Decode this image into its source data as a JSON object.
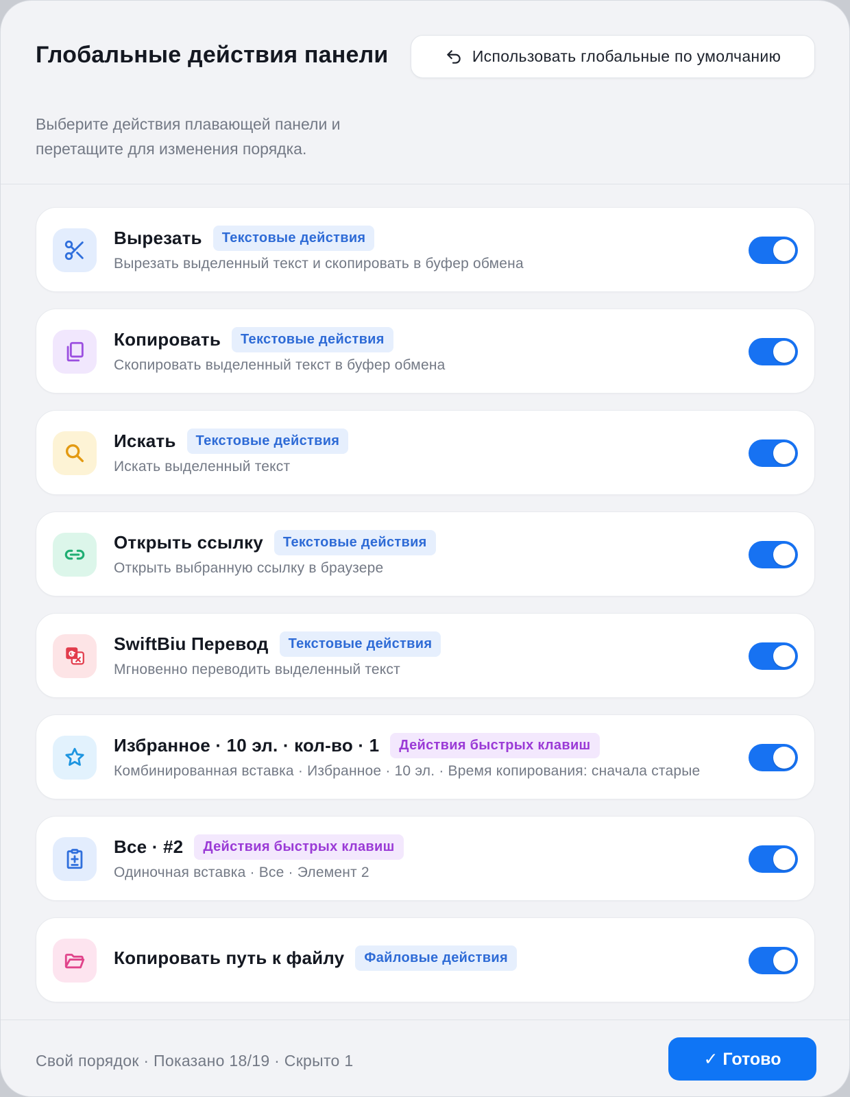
{
  "header": {
    "title": "Глобальные действия панели",
    "subtitle": "Выберите действия плавающей панели и перетащите для изменения порядка.",
    "reset_label": "Использовать глобальные по умолчанию"
  },
  "actions": [
    {
      "icon": "scissors-icon",
      "title": "Вырезать",
      "tag": "Текстовые действия",
      "desc": "Вырезать выделенный текст и скопировать в буфер обмена",
      "enabled": true
    },
    {
      "icon": "copy-icon",
      "title": "Копировать",
      "tag": "Текстовые действия",
      "desc": "Скопировать выделенный текст в буфер обмена",
      "enabled": true
    },
    {
      "icon": "search-icon",
      "title": "Искать",
      "tag": "Текстовые действия",
      "desc": "Искать выделенный текст",
      "enabled": true
    },
    {
      "icon": "link-icon",
      "title": "Открыть ссылку",
      "tag": "Текстовые действия",
      "desc": "Открыть выбранную ссылку в браузере",
      "enabled": true
    },
    {
      "icon": "translate-icon",
      "title": "SwiftBiu Перевод",
      "tag": "Текстовые действия",
      "desc": "Мгновенно переводить выделенный текст",
      "enabled": true
    },
    {
      "icon": "star-icon",
      "title": "Избранное · 10 эл. · кол-во · 1",
      "tag": "Действия быстрых клавиш",
      "desc": "Комбинированная вставка · Избранное · 10 эл. · Время копирования: сначала старые",
      "enabled": true
    },
    {
      "icon": "paste-icon",
      "title": "Все · #2",
      "tag": "Действия быстрых клавиш",
      "desc": "Одиночная вставка · Все · Элемент 2",
      "enabled": true
    },
    {
      "icon": "folder-icon",
      "title": "Копировать путь к файлу",
      "tag": "Файловые действия",
      "enabled": true
    }
  ],
  "footer": {
    "status": "Свой порядок · Показано 18/19 · Скрыто 1",
    "done_label": "✓ Готово"
  },
  "colors": {
    "accent": "#1772f2",
    "tag_blue_bg": "#e6effd",
    "tag_blue_text": "#2e6bd6",
    "tag_purple_bg": "#f3e8fd",
    "tag_purple_text": "#9a3ad6"
  }
}
